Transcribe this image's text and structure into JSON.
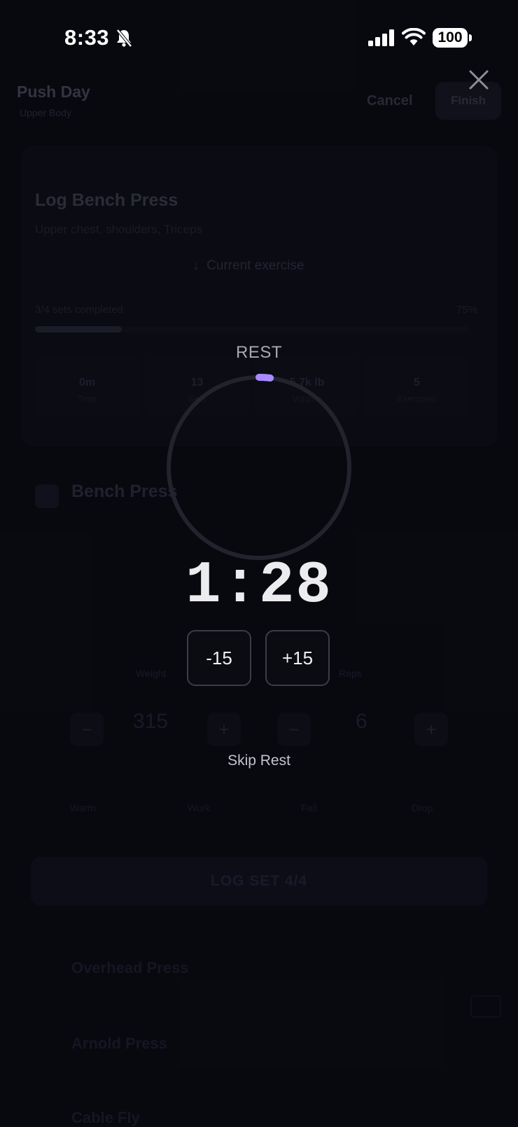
{
  "status_bar": {
    "time": "8:33",
    "battery": "100"
  },
  "background": {
    "workout_title": "Push Day",
    "workout_subtitle": "Upper Body",
    "cancel_label": "Cancel",
    "finish_label": "Finish",
    "log_title": "Log Bench Press",
    "muscles": "Upper chest, shoulders, Triceps",
    "current_exercise_label": "Current exercise",
    "progress_label": "3/4 sets completed",
    "progress_percent": "75%",
    "progress_fraction": 0.2,
    "stats": [
      {
        "value": "0m",
        "label": "Time"
      },
      {
        "value": "13",
        "label": "Sets"
      },
      {
        "value": "5.7k lb",
        "label": "Volume"
      },
      {
        "value": "5",
        "label": "Exercises"
      }
    ],
    "exercise_name": "Bench Press",
    "weight_label": "Weight",
    "weight_value": "315",
    "reps_label": "Reps",
    "reps_value": "6",
    "set_labels": [
      "Warm",
      "Work",
      "Fail",
      "Drop"
    ],
    "log_button": "LOG SET 4/4",
    "next_exercises": [
      "Overhead Press",
      "Arnold Press",
      "Cable Fly"
    ]
  },
  "rest": {
    "label": "REST",
    "timer": "1:28",
    "progress_fraction": 0.02,
    "minus_label": "-15",
    "plus_label": "+15",
    "skip_label": "Skip Rest",
    "accent_color": "#a98bff",
    "ring_color": "#22232d"
  }
}
